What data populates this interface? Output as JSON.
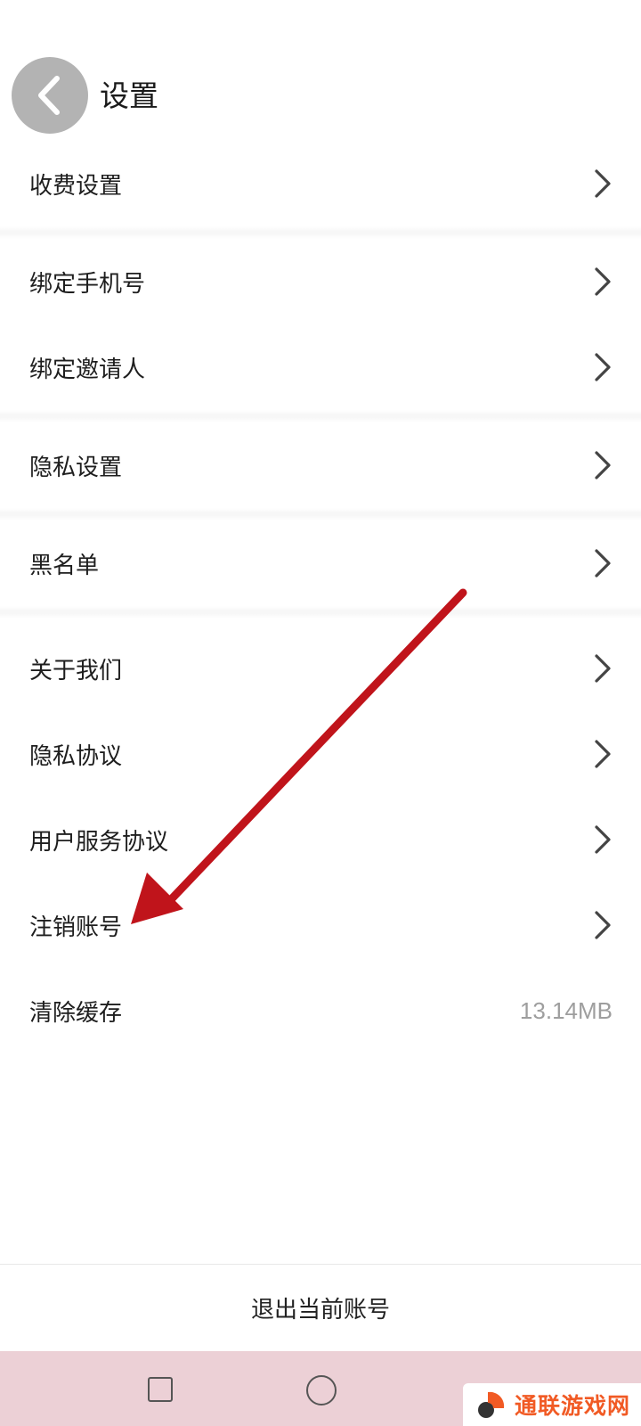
{
  "header": {
    "title": "设置",
    "back_icon": "chevron-left-icon"
  },
  "groups": [
    {
      "items": [
        {
          "label": "收费设置",
          "chevron": true
        }
      ]
    },
    {
      "items": [
        {
          "label": "绑定手机号",
          "chevron": true
        },
        {
          "label": "绑定邀请人",
          "chevron": true
        }
      ]
    },
    {
      "items": [
        {
          "label": "隐私设置",
          "chevron": true
        }
      ]
    },
    {
      "items": [
        {
          "label": "黑名单",
          "chevron": true
        }
      ]
    },
    {
      "items": [
        {
          "label": "关于我们",
          "chevron": true
        },
        {
          "label": "隐私协议",
          "chevron": true
        },
        {
          "label": "用户服务协议",
          "chevron": true
        },
        {
          "label": "注销账号",
          "chevron": true
        },
        {
          "label": "清除缓存",
          "value": "13.14MB"
        }
      ]
    }
  ],
  "footer": {
    "logout_label": "退出当前账号"
  },
  "navbar": {
    "icons": [
      "recent-apps-icon",
      "home-icon"
    ]
  },
  "watermark": {
    "text": "通联游戏网"
  },
  "colors": {
    "annotation_arrow": "#c0141b",
    "back_button": "#b3b3b3",
    "navbar": "#ecd0d6",
    "watermark_text": "#f15a24"
  }
}
